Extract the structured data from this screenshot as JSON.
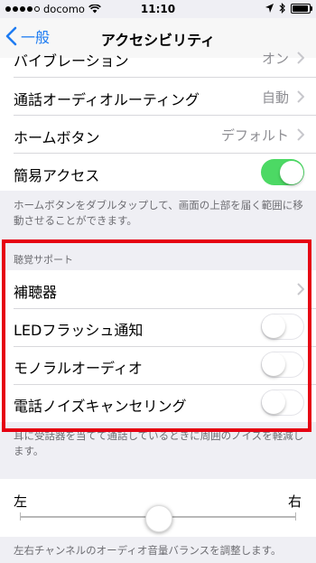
{
  "status_bar": {
    "carrier": "docomo",
    "time": "11:10"
  },
  "nav": {
    "back_label": "一般",
    "title": "アクセシビリティ"
  },
  "interaction_group": {
    "rows": [
      {
        "label": "バイブレーション",
        "value": "オン"
      },
      {
        "label": "通話オーディオルーティング",
        "value": "自動"
      },
      {
        "label": "ホームボタン",
        "value": "デフォルト"
      },
      {
        "label": "簡易アクセス",
        "toggle": "on"
      }
    ],
    "footer": "ホームボタンをダブルタップして、画面の上部を届く範囲に移動させることができます。"
  },
  "hearing_group": {
    "header": "聴覚サポート",
    "rows": [
      {
        "label": "補聴器"
      },
      {
        "label": "LEDフラッシュ通知",
        "toggle": "off"
      },
      {
        "label": "モノラルオーディオ",
        "toggle": "off"
      },
      {
        "label": "電話ノイズキャンセリング",
        "toggle": "off"
      }
    ],
    "footer": "耳に受話器を当てて通話しているときに周囲のノイズを軽減します。"
  },
  "balance": {
    "left_label": "左",
    "right_label": "右",
    "value": 0.5,
    "footer": "左右チャンネルのオーディオ音量バランスを調整します。"
  },
  "colors": {
    "accent": "#1e7cf2",
    "toggle_on": "#4cd964",
    "highlight_border": "#e60012"
  }
}
